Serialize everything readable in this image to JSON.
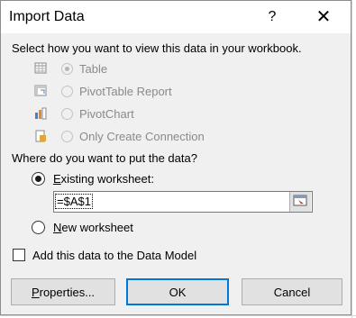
{
  "dialog": {
    "title": "Import Data",
    "help_label": "?",
    "close_label": "✕"
  },
  "view_section": {
    "prompt": "Select how you want to view this data in your workbook.",
    "options": [
      {
        "label": "Table",
        "icon": "table-icon",
        "selected": true,
        "enabled": false
      },
      {
        "label": "PivotTable Report",
        "icon": "pivottable-icon",
        "selected": false,
        "enabled": false
      },
      {
        "label": "PivotChart",
        "icon": "pivotchart-icon",
        "selected": false,
        "enabled": false
      },
      {
        "label": "Only Create Connection",
        "icon": "connection-icon",
        "selected": false,
        "enabled": false
      }
    ]
  },
  "location_section": {
    "prompt": "Where do you want to put the data?",
    "existing_label_accel": "E",
    "existing_label_rest": "xisting worksheet:",
    "existing_selected": true,
    "cell_reference": "=$A$1",
    "new_label_accel": "N",
    "new_label_rest": "ew worksheet"
  },
  "data_model": {
    "label": "Add this data to the Data Model",
    "checked": false
  },
  "buttons": {
    "properties_accel": "P",
    "properties_rest": "roperties...",
    "ok": "OK",
    "cancel": "Cancel"
  },
  "colors": {
    "dialog_bg": "#f0f0f0",
    "default_button_border": "#0078d7",
    "disabled_text": "#8a8a8a"
  }
}
